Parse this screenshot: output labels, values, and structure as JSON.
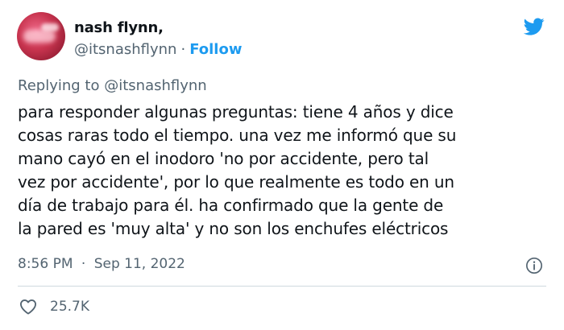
{
  "author": {
    "name": "nash flynn,",
    "handle": "@itsnashflynn",
    "separator": "·",
    "follow_label": "Follow"
  },
  "reply": {
    "prefix": "Replying to",
    "mention": "@itsnashflynn"
  },
  "tweet": {
    "text": "para responder algunas preguntas: tiene 4 años y dice\ncosas raras todo el tiempo. una vez me informó que su\nmano cayó en el inodoro 'no por accidente, pero tal\nvez por accidente', por lo que realmente es todo en un\ndía de trabajo para él. ha confirmado que la gente de\nla pared es 'muy alta' y no son los enchufes eléctricos",
    "time": "8:56 PM",
    "separator": "·",
    "date": "Sep 11, 2022"
  },
  "stats": {
    "likes": "25.7K"
  },
  "icons": {
    "brand": "twitter-bird-icon",
    "info": "info-icon",
    "like": "heart-icon"
  },
  "colors": {
    "brand": "#1d9bf0",
    "text": "#0f1419",
    "secondary": "#536471",
    "divider": "#cfd9de"
  }
}
